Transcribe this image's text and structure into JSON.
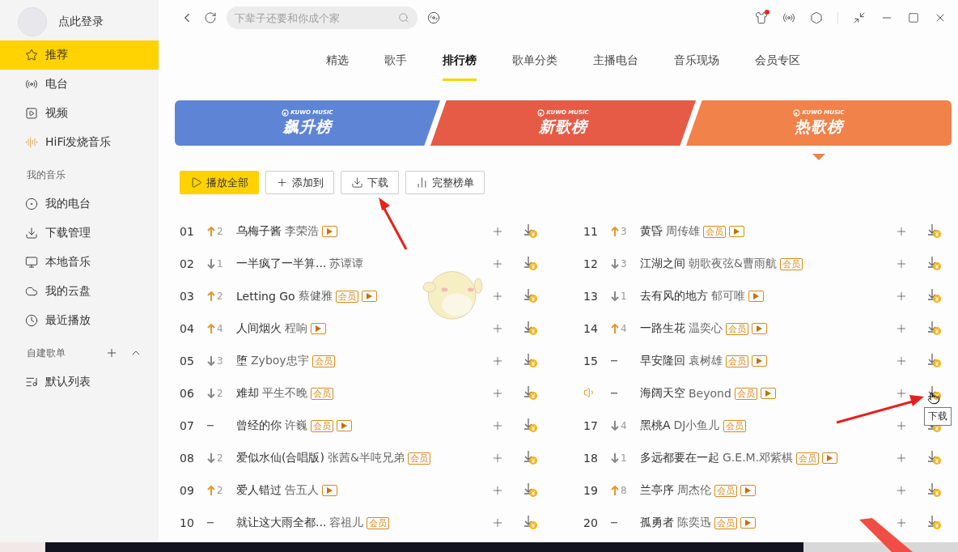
{
  "sidebar": {
    "login": "点此登录",
    "items": [
      {
        "label": "推荐",
        "selected": true
      },
      {
        "label": "电台",
        "selected": false
      },
      {
        "label": "视频",
        "selected": false
      },
      {
        "label": "HiFi发烧音乐",
        "selected": false
      }
    ],
    "my_music": {
      "title": "我的音乐",
      "items": [
        {
          "label": "我的电台",
          "selected": false
        },
        {
          "label": "下载管理",
          "selected": false
        },
        {
          "label": "本地音乐",
          "selected": false
        },
        {
          "label": "我的云盘",
          "selected": false
        },
        {
          "label": "最近播放",
          "selected": false
        }
      ]
    },
    "playlists": {
      "title": "自建歌单",
      "expanded": true,
      "items": [
        {
          "label": "默认列表",
          "selected": false
        }
      ]
    }
  },
  "search": {
    "placeholder": "下辈子还要和你成个家"
  },
  "tabs": [
    {
      "label": "精选",
      "selected": false
    },
    {
      "label": "歌手",
      "selected": false
    },
    {
      "label": "排行榜",
      "selected": true
    },
    {
      "label": "歌单分类",
      "selected": false
    },
    {
      "label": "主播电台",
      "selected": false
    },
    {
      "label": "音乐现场",
      "selected": false
    },
    {
      "label": "会员专区",
      "selected": false
    }
  ],
  "charts": [
    {
      "logo": "KUWO MUSIC",
      "title": "飙升榜",
      "color": "#5e84d6",
      "selected": false
    },
    {
      "logo": "KUWO MUSIC",
      "title": "新歌榜",
      "color": "#e55b45",
      "selected": false
    },
    {
      "logo": "KUWO MUSIC",
      "title": "热歌榜",
      "color": "#f0824a",
      "selected": true
    }
  ],
  "actions": [
    {
      "label": "播放全部",
      "kind": "primary"
    },
    {
      "label": "添加到",
      "kind": "add"
    },
    {
      "label": "下载",
      "kind": "download"
    },
    {
      "label": "完整榜单",
      "kind": "list"
    }
  ],
  "songs": [
    {
      "rank": "01",
      "kind": "up",
      "change": "2",
      "title": "乌梅子酱",
      "artist": "李荣浩",
      "mv": true,
      "playing": false
    },
    {
      "rank": "02",
      "kind": "down",
      "change": "1",
      "title": "一半疯了一半算...",
      "artist": "苏谭谭",
      "mv": false,
      "playing": false
    },
    {
      "rank": "03",
      "kind": "up",
      "change": "2",
      "title": "Letting Go",
      "artist": "蔡健雅",
      "badge": "会员",
      "mv": true,
      "playing": false
    },
    {
      "rank": "04",
      "kind": "up",
      "change": "4",
      "title": "人间烟火",
      "artist": "程响",
      "mv": true,
      "playing": false
    },
    {
      "rank": "05",
      "kind": "down",
      "change": "3",
      "title": "堕",
      "artist": "Zyboy忠宇",
      "badge": "会员",
      "mv": false,
      "playing": false
    },
    {
      "rank": "06",
      "kind": "down",
      "change": "2",
      "title": "难却",
      "artist": "平生不晚",
      "badge": "会员",
      "mv": false,
      "playing": false
    },
    {
      "rank": "07",
      "kind": "same",
      "title": "曾经的你",
      "artist": "许巍",
      "badge": "会员",
      "mv": true,
      "playing": false
    },
    {
      "rank": "08",
      "kind": "down",
      "change": "2",
      "title": "爱似水仙(合唱版)",
      "artist": "张茜&半吨兄弟",
      "badge": "会员",
      "mv": false,
      "playing": false
    },
    {
      "rank": "09",
      "kind": "up",
      "change": "2",
      "title": "爱人错过",
      "artist": "告五人",
      "mv": true,
      "playing": false
    },
    {
      "rank": "10",
      "kind": "same",
      "title": "就让这大雨全都...",
      "artist": "容祖儿",
      "badge": "会员",
      "mv": false,
      "playing": false
    },
    {
      "rank": "11",
      "kind": "up",
      "change": "3",
      "title": "黄昏",
      "artist": "周传雄",
      "badge": "会员",
      "mv": true,
      "playing": false
    },
    {
      "rank": "12",
      "kind": "down",
      "change": "3",
      "title": "江湖之间",
      "artist": "朝歌夜弦&曹雨航",
      "badge": "会员",
      "mv": false,
      "playing": false
    },
    {
      "rank": "13",
      "kind": "down",
      "change": "1",
      "title": "去有风的地方",
      "artist": "郁可唯",
      "mv": true,
      "playing": false
    },
    {
      "rank": "14",
      "kind": "up",
      "change": "4",
      "title": "一路生花",
      "artist": "温奕心",
      "badge": "会员",
      "mv": true,
      "playing": false
    },
    {
      "rank": "15",
      "kind": "same",
      "title": "早安隆回",
      "artist": "袁树雄",
      "badge": "会员",
      "mv": true,
      "playing": false
    },
    {
      "kind": "same",
      "title": "海阔天空",
      "artist": "Beyond",
      "badge": "会员",
      "mv": true,
      "playing": true
    },
    {
      "rank": "17",
      "kind": "down",
      "change": "4",
      "title": "黑桃A",
      "artist": "DJ小鱼儿",
      "badge": "会员",
      "mv": false,
      "playing": false
    },
    {
      "rank": "18",
      "kind": "down",
      "change": "1",
      "title": "多远都要在一起",
      "artist": "G.E.M.邓紫棋",
      "badge": "会员",
      "mv": true,
      "playing": false
    },
    {
      "rank": "19",
      "kind": "up",
      "change": "8",
      "title": "兰亭序",
      "artist": "周杰伦",
      "badge": "会员",
      "mv": true,
      "playing": false
    },
    {
      "rank": "20",
      "kind": "same",
      "title": "孤勇者",
      "artist": "陈奕迅",
      "badge": "会员",
      "mv": true,
      "playing": false
    }
  ],
  "tooltip": "下载"
}
